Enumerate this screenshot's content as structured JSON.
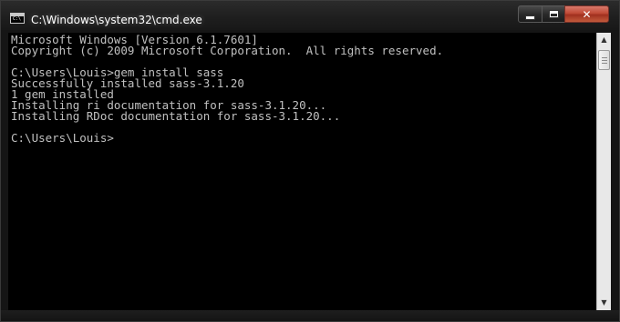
{
  "window": {
    "title": "C:\\Windows\\system32\\cmd.exe",
    "icon": "cmd-icon",
    "icon_text": "C:\\",
    "controls": {
      "minimize_icon": "minimize-icon",
      "maximize_icon": "maximize-icon",
      "close_icon": "close-icon",
      "close_glyph": "✕"
    }
  },
  "console": {
    "lines": [
      "Microsoft Windows [Version 6.1.7601]",
      "Copyright (c) 2009 Microsoft Corporation.  All rights reserved.",
      "",
      "C:\\Users\\Louis>gem install sass",
      "Successfully installed sass-3.1.20",
      "1 gem installed",
      "Installing ri documentation for sass-3.1.20...",
      "Installing RDoc documentation for sass-3.1.20...",
      "",
      "C:\\Users\\Louis>"
    ],
    "text_color": "#c0c0c0",
    "background": "#000000"
  },
  "scrollbar": {
    "up_glyph": "▲",
    "down_glyph": "▼"
  }
}
